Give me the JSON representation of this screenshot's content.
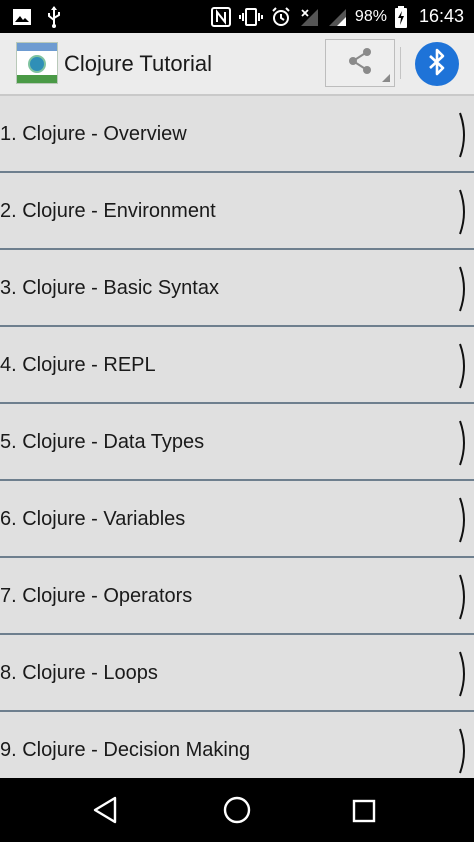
{
  "status_bar": {
    "battery": "98%",
    "time": "16:43",
    "icons": [
      "image-icon",
      "usb-icon",
      "nfc-icon",
      "vibrate-icon",
      "alarm-icon",
      "no-signal-icon",
      "signal-icon",
      "battery-charging-icon"
    ]
  },
  "app_bar": {
    "title": "Clojure Tutorial",
    "logo_icon": "app-logo-icon",
    "share_icon": "share-icon",
    "bluetooth_icon": "bluetooth-icon",
    "bluetooth_color": "#1e73d8"
  },
  "list": {
    "items": [
      {
        "label": "1. Clojure - Overview"
      },
      {
        "label": "2. Clojure - Environment"
      },
      {
        "label": "3. Clojure - Basic Syntax"
      },
      {
        "label": "4. Clojure - REPL"
      },
      {
        "label": "5. Clojure - Data Types"
      },
      {
        "label": "6. Clojure - Variables"
      },
      {
        "label": "7. Clojure - Operators"
      },
      {
        "label": "8. Clojure - Loops"
      },
      {
        "label": "9. Clojure - Decision Making"
      }
    ],
    "chevron_icon": "chevron-right-icon"
  },
  "nav_bar": {
    "icons": [
      "back-icon",
      "home-icon",
      "recents-icon"
    ]
  }
}
